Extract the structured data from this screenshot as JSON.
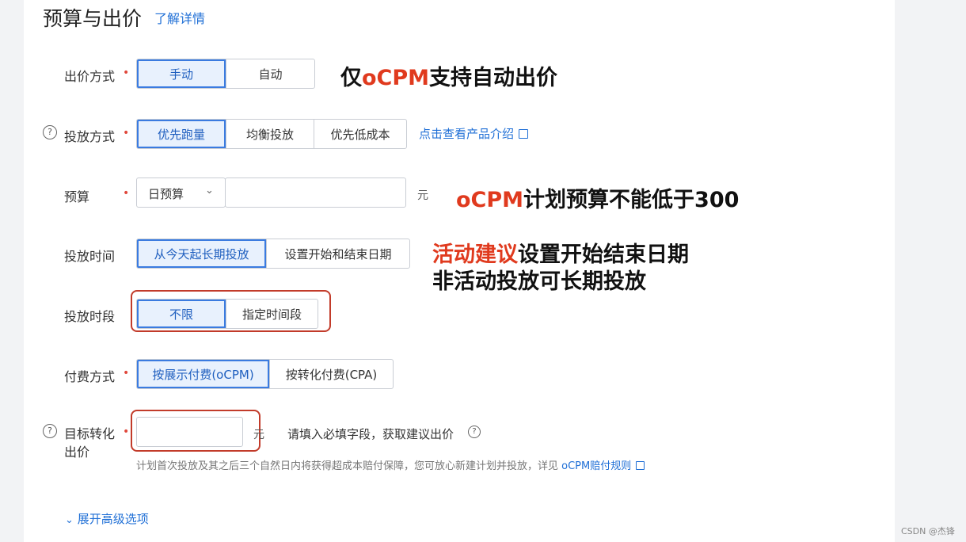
{
  "header": {
    "title": "预算与出价",
    "learn_more": "了解详情"
  },
  "bid_method": {
    "label": "出价方式",
    "required": "•",
    "options": [
      "手动",
      "自动"
    ],
    "selected": "手动",
    "note_prefix": "仅",
    "note_highlight": "oCPM",
    "note_suffix": "支持自动出价"
  },
  "delivery_method": {
    "label": "投放方式",
    "required": "•",
    "help": "?",
    "options": [
      "优先跑量",
      "均衡投放",
      "优先低成本"
    ],
    "selected": "优先跑量",
    "link": "点击查看产品介绍"
  },
  "budget": {
    "label": "预算",
    "required": "•",
    "type_value": "日预算",
    "amount_value": "",
    "unit": "元",
    "note_highlight": "oCPM",
    "note_suffix": "计划预算不能低于300"
  },
  "delivery_time": {
    "label": "投放时间",
    "options": [
      "从今天起长期投放",
      "设置开始和结束日期"
    ],
    "selected": "从今天起长期投放",
    "note_line1_highlight": "活动建议",
    "note_line1_suffix": "设置开始结束日期",
    "note_line2": "非活动投放可长期投放"
  },
  "time_period": {
    "label": "投放时段",
    "options": [
      "不限",
      "指定时间段"
    ],
    "selected": "不限"
  },
  "payment": {
    "label": "付费方式",
    "required": "•",
    "options": [
      "按展示付费(oCPM)",
      "按转化付费(CPA)"
    ],
    "selected": "按展示付费(oCPM)"
  },
  "target_bid": {
    "label_line1": "目标转化",
    "label_line2": "出价",
    "required": "•",
    "help": "?",
    "value": "",
    "unit": "元",
    "suggest_text": "请填入必填字段，获取建议出价",
    "guarantee_text": "计划首次投放及其之后三个自然日内将获得超成本赔付保障，您可放心新建计划并投放，详见",
    "guarantee_link": "oCPM赔付规则"
  },
  "advanced": {
    "label": "展开高级选项"
  },
  "watermark": "CSDN @杰锋",
  "colors": {
    "accent": "#1f6fd6",
    "highlight": "#e03a1e",
    "annotation_box": "#c23b2a"
  }
}
